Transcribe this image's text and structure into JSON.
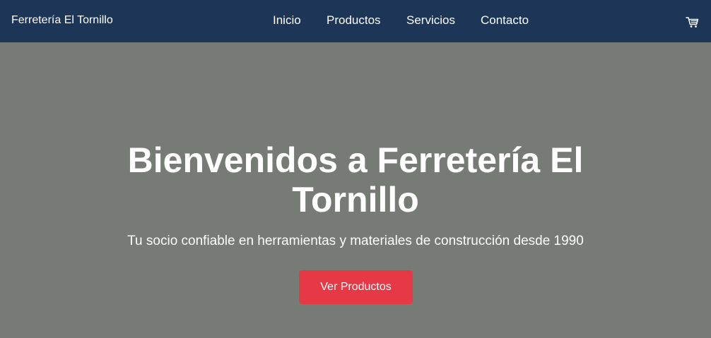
{
  "navbar": {
    "brand": "Ferretería El Tornillo",
    "links": [
      "Inicio",
      "Productos",
      "Servicios",
      "Contacto"
    ],
    "cart_icon": "shopping-cart-icon"
  },
  "hero": {
    "title": "Bienvenidos a Ferretería El Tornillo",
    "subtitle": "Tu socio confiable en herramientas y materiales de construcción desde 1990",
    "button_label": "Ver Productos"
  },
  "colors": {
    "navbar_bg": "#1d3557",
    "hero_bg": "#777b75",
    "accent": "#e63946",
    "text": "#ffffff"
  }
}
